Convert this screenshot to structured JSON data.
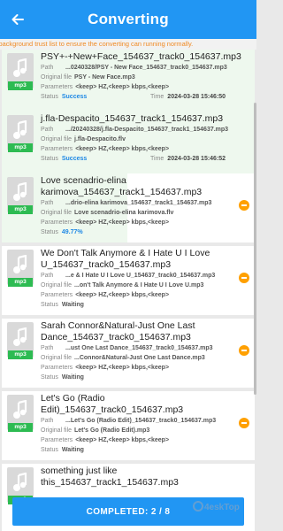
{
  "header": {
    "title": "Converting"
  },
  "notice": "r background trust list to ensure the converting can running normally.",
  "labels": {
    "path": "Path",
    "original": "Original file",
    "parameters": "Parameters",
    "status": "Status",
    "time": "Time"
  },
  "items": [
    {
      "name": "PSY+-+New+Face_154637_track0_154637.mp3",
      "path": "...0240328/PSY - New Face_154637_track0_154637.mp3",
      "original": "PSY - New Face.mp3",
      "parameters": "<keep> HZ,<keep> kbps,<keep>",
      "status": "Success",
      "time": "2024-03-28 15:46:50",
      "badge": "mp3"
    },
    {
      "name": "j.fla-Despacito_154637_track1_154637.mp3",
      "path": ".../20240328/j.fla-Despacito_154637_track1_154637.mp3",
      "original": "j.fla-Despacito.flv",
      "parameters": "<keep> HZ,<keep> kbps,<keep>",
      "status": "Success",
      "time": "2024-03-28 15:46:52",
      "badge": "mp3"
    },
    {
      "name": "Love scenadrio-elina karimova_154637_track1_154637.mp3",
      "path": "...drio-elina karimova_154637_track1_154637.mp3",
      "original": "Love scenadrio-elina karimova.flv",
      "parameters": "<keep> HZ,<keep> kbps,<keep>",
      "status": "49.77%",
      "progress": 0.4977,
      "badge": "mp3"
    },
    {
      "name": "We Don't Talk Anymore & I Hate U I Love U_154637_track0_154637.mp3",
      "path": "...e & I Hate U I Love U_154637_track0_154637.mp3",
      "original": "...on't Talk Anymore & I Hate U I Love U.mp3",
      "parameters": "<keep> HZ,<keep> kbps,<keep>",
      "status": "Waiting",
      "badge": "mp3"
    },
    {
      "name": "Sarah Connor&Natural-Just One Last Dance_154637_track0_154637.mp3",
      "path": "...ust One Last Dance_154637_track0_154637.mp3",
      "original": "...Connor&Natural-Just One Last Dance.mp3",
      "parameters": "<keep> HZ,<keep> kbps,<keep>",
      "status": "Waiting",
      "badge": "mp3"
    },
    {
      "name": "Let's Go (Radio Edit)_154637_track0_154637.mp3",
      "path": "...Let's Go (Radio Edit)_154637_track0_154637.mp3",
      "original": "Let's Go (Radio Edit).mp3",
      "parameters": "<keep> HZ,<keep> kbps,<keep>",
      "status": "Waiting",
      "badge": "mp3"
    },
    {
      "name": "something just like this_154637_track1_154637.mp3",
      "badge": "mp3"
    }
  ],
  "footer": {
    "completed_label": "COMPLETED: 2 / 8"
  },
  "watermark": "4eskTop",
  "colors": {
    "accent": "#2196f3",
    "success": "#1e88e5",
    "badge": "#2dbb52",
    "remove": "#ffa000",
    "notice": "#f08a24"
  }
}
